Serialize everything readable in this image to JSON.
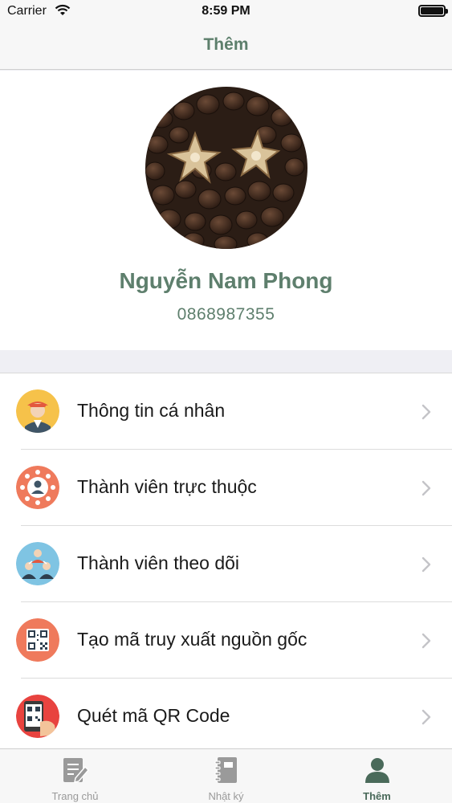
{
  "status_bar": {
    "carrier": "Carrier",
    "time": "8:59 PM"
  },
  "nav": {
    "title": "Thêm"
  },
  "profile": {
    "name": "Nguyễn Nam Phong",
    "phone": "0868987355"
  },
  "menu": {
    "items": [
      {
        "label": "Thông tin cá nhân",
        "icon": "farmer-avatar-icon"
      },
      {
        "label": "Thành viên trực thuộc",
        "icon": "member-group-icon"
      },
      {
        "label": "Thành viên theo dõi",
        "icon": "followers-icon"
      },
      {
        "label": "Tạo mã truy xuất nguồn gốc",
        "icon": "qr-code-icon"
      },
      {
        "label": "Quét mã QR Code",
        "icon": "qr-scan-phone-icon"
      }
    ]
  },
  "tabs": [
    {
      "label": "Trang chủ",
      "icon": "document-edit-icon",
      "active": false
    },
    {
      "label": "Nhật ký",
      "icon": "notebook-icon",
      "active": false
    },
    {
      "label": "Thêm",
      "icon": "person-icon",
      "active": true
    }
  ],
  "colors": {
    "accent": "#5e7f6d",
    "tab_active": "#4a6a5a",
    "tab_inactive": "#9a9a9a"
  }
}
